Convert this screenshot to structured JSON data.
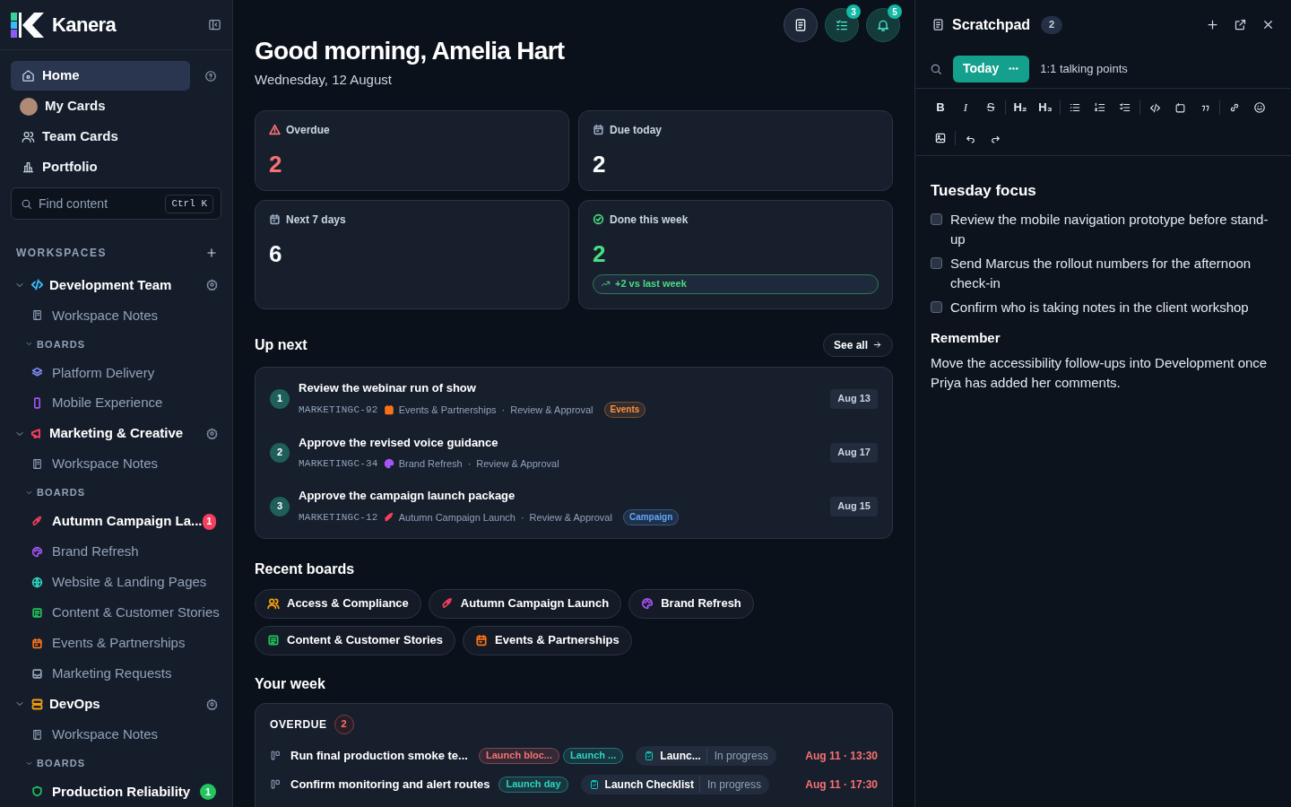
{
  "brand": {
    "name": "Kanera"
  },
  "nav": [
    {
      "label": "Home",
      "selected": true
    },
    {
      "label": "My Cards",
      "selected": false
    },
    {
      "label": "Team Cards",
      "selected": false
    },
    {
      "label": "Portfolio",
      "selected": false
    }
  ],
  "search": {
    "placeholder": "Find content",
    "shortcut": "Ctrl K"
  },
  "workspaces_label": "WORKSPACES",
  "workspaces": [
    {
      "name": "Development Team",
      "color": "#38bdf8",
      "expanded": true,
      "notes": "Workspace Notes",
      "boards_label": "BOARDS",
      "boards": [
        {
          "name": "Platform Delivery",
          "color": "#818cf8"
        },
        {
          "name": "Mobile Experience",
          "color": "#a855f7"
        }
      ]
    },
    {
      "name": "Marketing & Creative",
      "color": "#f43f5e",
      "expanded": true,
      "notes": "Workspace Notes",
      "boards_label": "BOARDS",
      "boards": [
        {
          "name": "Autumn Campaign La...",
          "color": "#f43f5e",
          "badge": "1"
        },
        {
          "name": "Brand Refresh",
          "color": "#a855f7"
        },
        {
          "name": "Website & Landing Pages",
          "color": "#2dd4bf"
        },
        {
          "name": "Content & Customer Stories",
          "color": "#22c55e"
        },
        {
          "name": "Events & Partnerships",
          "color": "#f97316"
        },
        {
          "name": "Marketing Requests",
          "color": "#94a3b8"
        }
      ]
    },
    {
      "name": "DevOps",
      "color": "#f59e0b",
      "expanded": true,
      "notes": "Workspace Notes",
      "boards_label": "BOARDS",
      "boards": [
        {
          "name": "Production Reliability",
          "color": "#22c55e",
          "badge": "1"
        }
      ]
    }
  ],
  "header": {
    "greeting": "Good morning, Amelia Hart",
    "date": "Wednesday, 12 August",
    "tasks_badge": "3",
    "notifications_badge": "5"
  },
  "stats": [
    {
      "label": "Overdue",
      "value": "2",
      "color": "#f87171"
    },
    {
      "label": "Due today",
      "value": "2",
      "color": "#f8fafc"
    },
    {
      "label": "Next 7 days",
      "value": "6",
      "color": "#f8fafc"
    },
    {
      "label": "Done this week",
      "value": "2",
      "color": "#4ade80",
      "trend": "+2 vs last week"
    }
  ],
  "up_next": {
    "title": "Up next",
    "see_all": "See all",
    "separator": "·",
    "items": [
      {
        "number": "1",
        "title": "Review the webinar run of show",
        "key": "MARKETINGC-92",
        "board": "Events & Partnerships",
        "color": "#f97316",
        "stage": "Review & Approval",
        "tag": {
          "label": "Events",
          "color": "#fb923c"
        },
        "date": "Aug 13"
      },
      {
        "number": "2",
        "title": "Approve the revised voice guidance",
        "key": "MARKETINGC-34",
        "board": "Brand Refresh",
        "color": "#a855f7",
        "stage": "Review & Approval",
        "date": "Aug 17"
      },
      {
        "number": "3",
        "title": "Approve the campaign launch package",
        "key": "MARKETINGC-12",
        "board": "Autumn Campaign Launch",
        "color": "#f43f5e",
        "stage": "Review & Approval",
        "tag": {
          "label": "Campaign",
          "color": "#60a5fa"
        },
        "date": "Aug 15"
      }
    ]
  },
  "recent_boards": {
    "title": "Recent boards",
    "items": [
      {
        "name": "Access & Compliance",
        "color": "#f59e0b"
      },
      {
        "name": "Autumn Campaign Launch",
        "color": "#f43f5e"
      },
      {
        "name": "Brand Refresh",
        "color": "#a855f7"
      },
      {
        "name": "Content & Customer Stories",
        "color": "#22c55e"
      },
      {
        "name": "Events & Partnerships",
        "color": "#f97316"
      }
    ]
  },
  "your_week": {
    "title": "Your week",
    "section": "OVERDUE",
    "count": "2",
    "rows": [
      {
        "title": "Run final production smoke te...",
        "tags": [
          {
            "label": "Launch bloc...",
            "color": "#f87171"
          },
          {
            "label": "Launch ...",
            "color": "#2dd4bf"
          }
        ],
        "board": "Launc...",
        "status": "In progress",
        "time": "Aug 11 · 13:30"
      },
      {
        "title": "Confirm monitoring and alert routes",
        "tags": [
          {
            "label": "Launch day",
            "color": "#2dd4bf"
          }
        ],
        "board": "Launch Checklist",
        "status": "In progress",
        "time": "Aug 11 · 17:30"
      }
    ]
  },
  "scratchpad": {
    "title": "Scratchpad",
    "count": "2",
    "tabs": [
      {
        "label": "Today",
        "selected": true
      },
      {
        "label": "1:1 talking points",
        "selected": false
      }
    ],
    "format_buttons": [
      "B",
      "I",
      "S",
      "H₂",
      "H₃"
    ],
    "heading": "Tuesday focus",
    "checklist": [
      {
        "text": "Review the mobile navigation prototype before stand-up",
        "checked": false
      },
      {
        "text": "Send Marcus the rollout numbers for the afternoon check-in",
        "checked": false
      },
      {
        "text": "Confirm who is taking notes in the client workshop",
        "checked": false
      }
    ],
    "note_heading": "Remember",
    "note": "Move the accessibility follow-ups into Development once Priya has added her comments."
  }
}
